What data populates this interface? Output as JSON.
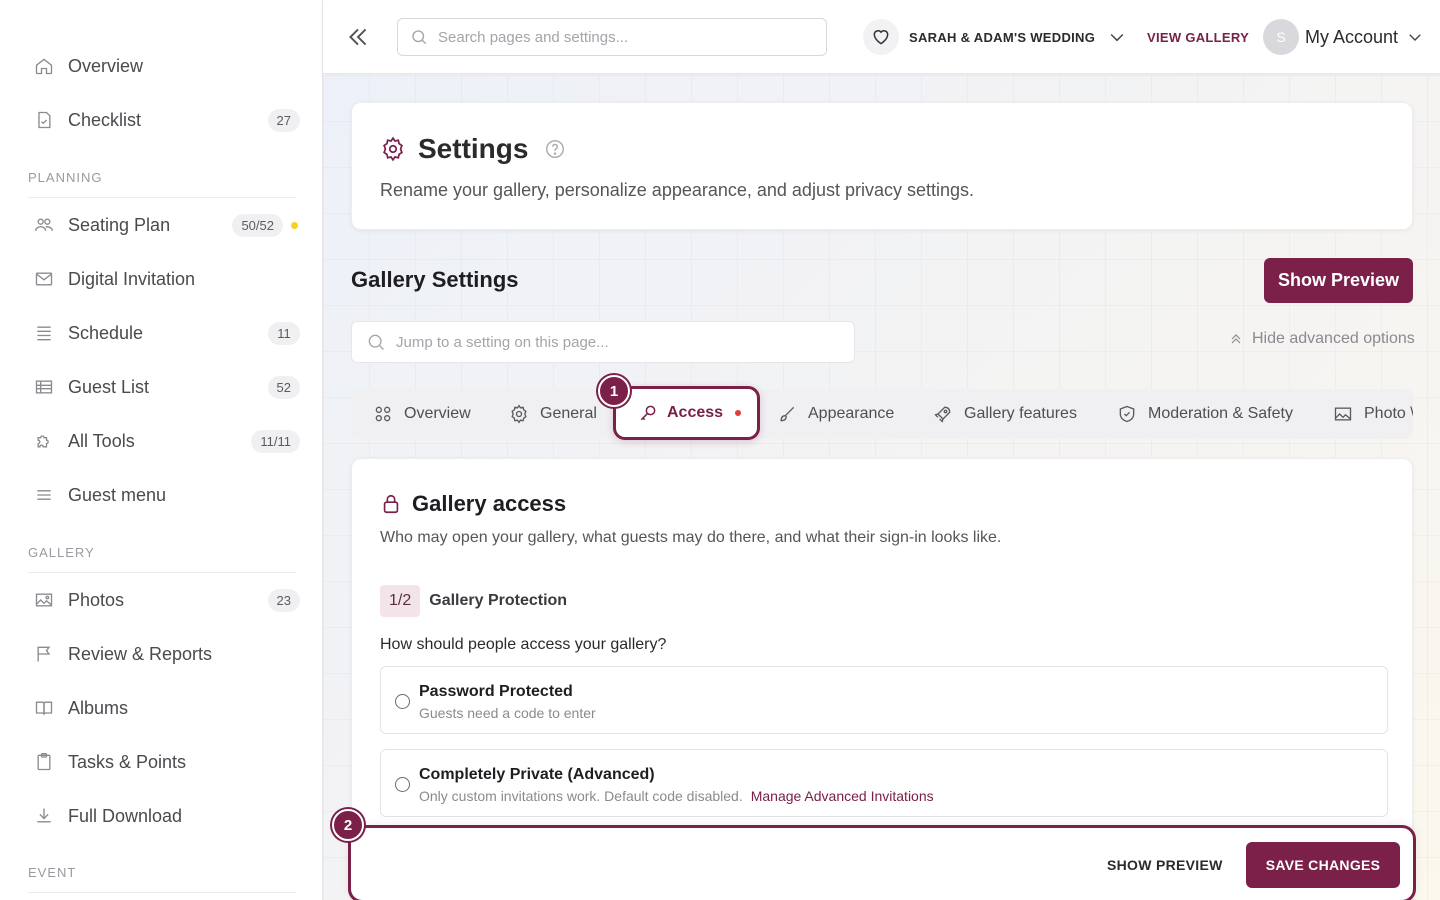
{
  "sidebar": {
    "items": [
      {
        "label": "Overview",
        "icon": "home-icon"
      },
      {
        "label": "Checklist",
        "icon": "checklist-icon",
        "badge": "27"
      },
      {
        "label": "Seating Plan",
        "icon": "seating-icon",
        "badge": "50/52"
      },
      {
        "label": "Digital Invitation",
        "icon": "envelope-icon"
      },
      {
        "label": "Schedule",
        "icon": "schedule-icon",
        "badge": "11"
      },
      {
        "label": "Guest List",
        "icon": "guest-list-icon",
        "badge": "52"
      },
      {
        "label": "All Tools",
        "icon": "puzzle-icon",
        "badge": "11/11"
      },
      {
        "label": "Guest menu",
        "icon": "menu-icon"
      },
      {
        "label": "Photos",
        "icon": "photo-icon",
        "badge": "23"
      },
      {
        "label": "Review & Reports",
        "icon": "flag-icon"
      },
      {
        "label": "Albums",
        "icon": "book-icon"
      },
      {
        "label": "Tasks & Points",
        "icon": "clipboard-icon"
      },
      {
        "label": "Full Download",
        "icon": "download-icon"
      }
    ],
    "sections": {
      "planning": "PLANNING",
      "gallery": "GALLERY",
      "event": "EVENT"
    }
  },
  "topbar": {
    "search_placeholder": "Search pages and settings...",
    "event_name": "SARAH & ADAM'S WEDDING",
    "view_gallery": "VIEW GALLERY",
    "avatar_initial": "S",
    "account": "My Account"
  },
  "settings": {
    "title": "Settings",
    "subtitle": "Rename your gallery, personalize appearance, and adjust privacy settings."
  },
  "gallery_settings": {
    "title": "Gallery Settings",
    "show_preview": "Show Preview",
    "jump_placeholder": "Jump to a setting on this page...",
    "hide_advanced": "Hide advanced options"
  },
  "tabs": {
    "overview": "Overview",
    "general": "General",
    "access": "Access",
    "appearance": "Appearance",
    "gallery_features": "Gallery features",
    "moderation": "Moderation & Safety",
    "photo": "Photo \\"
  },
  "steps": {
    "one": "1",
    "two": "2"
  },
  "access": {
    "title": "Gallery access",
    "subtitle": "Who may open your gallery, what guests may do there, and what their sign-in looks like.",
    "progress": "1/2",
    "progress_label": "Gallery Protection",
    "question": "How should people access your gallery?",
    "options": [
      {
        "title": "Password Protected",
        "desc": "Guests need a code to enter"
      },
      {
        "title": "Completely Private (Advanced)",
        "desc": "Only custom invitations work. Default code disabled.",
        "link": "Manage Advanced Invitations"
      }
    ]
  },
  "action_bar": {
    "show_preview": "SHOW PREVIEW",
    "save": "SAVE CHANGES"
  },
  "colors": {
    "accent": "#7a2049",
    "badge_dot": "#f5d21f",
    "tab_dot": "#e23b3b"
  }
}
